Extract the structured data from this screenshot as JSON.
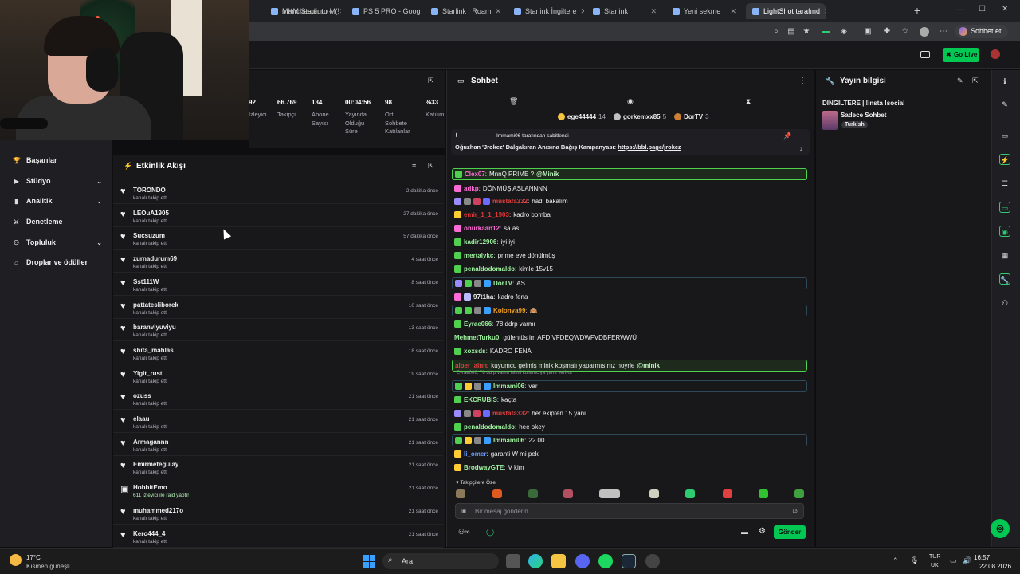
{
  "browser": {
    "tabs": [
      {
        "label": "MKM Stadium – (!",
        "active": false
      },
      {
        "label": "manchester to M",
        "active": false
      },
      {
        "label": "PS 5 PRO - Goog",
        "active": false
      },
      {
        "label": "Starlink | Roam",
        "active": false
      },
      {
        "label": "Starlink İngiltere",
        "active": false
      },
      {
        "label": "Starlink",
        "active": false
      },
      {
        "label": "Yeni sekme",
        "active": false
      },
      {
        "label": "LightShot tarafınd",
        "active": true
      }
    ],
    "profile_label": "Sohbet et"
  },
  "topnav": {
    "go_live": "Go Live"
  },
  "sidebar": {
    "items": [
      {
        "label": "Başarılar",
        "icon": "trophy-icon",
        "expandable": false
      },
      {
        "label": "Stüdyo",
        "icon": "video-icon",
        "expandable": true
      },
      {
        "label": "Analitik",
        "icon": "chart-icon",
        "expandable": true
      },
      {
        "label": "Denetleme",
        "icon": "sword-icon",
        "expandable": false
      },
      {
        "label": "Topluluk",
        "icon": "people-icon",
        "expandable": true
      },
      {
        "label": "Droplar ve ödüller",
        "icon": "gift-icon",
        "expandable": false
      }
    ]
  },
  "stats": [
    {
      "value": "92",
      "label": "Izleyici"
    },
    {
      "value": "66.769",
      "label": "Takipçi"
    },
    {
      "value": "134",
      "label": "Abone Sayısı"
    },
    {
      "value": "00:04:56",
      "label": "Yayında Olduğu Süre"
    },
    {
      "value": "98",
      "label": "Ort. Sohbete Katılanlar"
    },
    {
      "value": "%33",
      "label": "Katılım"
    }
  ],
  "feed": {
    "title": "Etkinlik Akışı",
    "items": [
      {
        "name": "TORONDO",
        "action": "kanalı takip etti",
        "time": "2 dakika önce",
        "icon": "heart-icon"
      },
      {
        "name": "LEOuA1905",
        "action": "kanalı takip etti",
        "time": "27 dakika önce",
        "icon": "heart-icon"
      },
      {
        "name": "Sucsuzum",
        "action": "kanalı takip etti",
        "time": "57 dakika önce",
        "icon": "heart-icon"
      },
      {
        "name": "zurnadurum69",
        "action": "kanalı takip etti",
        "time": "4 saat önce",
        "icon": "heart-icon"
      },
      {
        "name": "Sst111W",
        "action": "kanalı takip etti",
        "time": "8 saat önce",
        "icon": "heart-icon"
      },
      {
        "name": "pattatesliborek",
        "action": "kanalı takip etti",
        "time": "10 saat önce",
        "icon": "heart-icon"
      },
      {
        "name": "baranviyuviyu",
        "action": "kanalı takip etti",
        "time": "13 saat önce",
        "icon": "heart-icon"
      },
      {
        "name": "shifa_mahlas",
        "action": "kanalı takip etti",
        "time": "18 saat önce",
        "icon": "heart-icon"
      },
      {
        "name": "Yigit_rust",
        "action": "kanalı takip etti",
        "time": "19 saat önce",
        "icon": "heart-icon"
      },
      {
        "name": "ozuss",
        "action": "kanalı takip etti",
        "time": "21 saat önce",
        "icon": "heart-icon"
      },
      {
        "name": "elaau",
        "action": "kanalı takip etti",
        "time": "21 saat önce",
        "icon": "heart-icon"
      },
      {
        "name": "Armagannn",
        "action": "kanalı takip etti",
        "time": "21 saat önce",
        "icon": "heart-icon"
      },
      {
        "name": "Emirmeteguiay",
        "action": "kanalı takip etti",
        "time": "21 saat önce",
        "icon": "heart-icon"
      },
      {
        "name": "HobbitEmo",
        "action": "611 izleyici ile raid yaptı!",
        "time": "21 saat önce",
        "icon": "raid-icon"
      },
      {
        "name": "muhammed217o",
        "action": "kanalı takip etti",
        "time": "21 saat önce",
        "icon": "heart-icon"
      },
      {
        "name": "Kero444_4",
        "action": "kanalı takip etti",
        "time": "21 saat önce",
        "icon": "heart-icon"
      }
    ]
  },
  "chat": {
    "title": "Sohbet",
    "top_chatters": [
      {
        "name": "ege44444",
        "count": "14"
      },
      {
        "name": "gorkemxx85",
        "count": "5"
      },
      {
        "name": "DorTV",
        "count": "3"
      }
    ],
    "pinned_by": "Immami06 tarafından sabitlendi",
    "pinned_text": "Oğuzhan 'Jrokez' Dalgakıran Anısına Bağış Kampanyası:",
    "pinned_link": "https://bbl.page/jrokez",
    "messages": [
      {
        "user": "Clex07",
        "color": "#ff6bd6",
        "text": "MnnQ PRİME ?",
        "mention": "@Minik",
        "style": "hl",
        "badges": [
          "#4fd14f"
        ]
      },
      {
        "user": "adkp",
        "color": "#ff6bd6",
        "text": "DÖNMÜŞ ASLANNNN",
        "style": "",
        "badges": [
          "#ff6bd6"
        ]
      },
      {
        "user": "mustafa332",
        "color": "#e04040",
        "text": "hadi bakalım",
        "style": "",
        "badges": [
          "#9a8cff",
          "#888888",
          "#d04060",
          "#6b6bff"
        ]
      },
      {
        "user": "emir_1_1_1903",
        "color": "#e03535",
        "text": "kadro bomba",
        "style": "",
        "badges": [
          "#ffcc33"
        ]
      },
      {
        "user": "onurkaan12",
        "color": "#ff6bd6",
        "text": "sa as",
        "style": "",
        "badges": [
          "#ff6bd6"
        ]
      },
      {
        "user": "kadir12906",
        "color": "#9df29d",
        "text": "iyi iyi",
        "style": "",
        "badges": [
          "#4fd14f"
        ]
      },
      {
        "user": "mertalykc",
        "color": "#9df29d",
        "text": "prime eve dönülmüş",
        "style": "",
        "badges": [
          "#4fd14f"
        ]
      },
      {
        "user": "penaldodomaldo",
        "color": "#9df29d",
        "text": "kimle 15v15",
        "style": "",
        "badges": [
          "#4fd14f"
        ]
      },
      {
        "user": "DorTV",
        "color": "#9df29d",
        "text": "AS",
        "style": "hl2",
        "badges": [
          "#9a8cff",
          "#4fd14f",
          "#888888",
          "#3aa0ff"
        ]
      },
      {
        "user": "97t1ha",
        "color": "#efeff1",
        "text": "kadro fena",
        "style": "",
        "badges": [
          "#ff6bd6",
          "#bbbbff"
        ]
      },
      {
        "user": "Kolonya99",
        "color": "#f0a020",
        "text": "🙈",
        "style": "hl2",
        "badges": [
          "#4fd14f",
          "#4fd14f",
          "#888888",
          "#3aa0ff"
        ]
      },
      {
        "user": "Eyrae066",
        "color": "#9df29d",
        "text": "78 ddrp varmı",
        "style": "",
        "badges": [
          "#4fd14f"
        ]
      },
      {
        "user": "MehmetTurku0",
        "color": "#9df29d",
        "text": "gülentüs im AFD VFDEQWDWFVDBFERWWÜ",
        "style": "",
        "badges": []
      },
      {
        "user": "xoxsds",
        "color": "#9df29d",
        "text": "KADRO FENA",
        "style": "",
        "badges": [
          "#4fd14f"
        ]
      },
      {
        "user": "alper_alnn",
        "color": "#e04040",
        "text": "kuyumcu gelmiş minik koşmalı yaparmısınız noyrle",
        "mention": "@minik",
        "style": "hl",
        "badges": []
      },
      {
        "user": "Immami06",
        "color": "#9df29d",
        "text": "var",
        "reply": "Eyrae066: 78 ddrp varmı isimli kullanıcıya yanıt veriyor",
        "style": "hl2",
        "badges": [
          "#4fd14f",
          "#ffcc33",
          "#888888",
          "#3aa0ff"
        ]
      },
      {
        "user": "EKCRUBIS",
        "color": "#9df29d",
        "text": "kaçta",
        "style": "",
        "badges": [
          "#4fd14f"
        ]
      },
      {
        "user": "mustafa332",
        "color": "#e04040",
        "text": "her ekipten 15 yani",
        "style": "",
        "badges": [
          "#9a8cff",
          "#888888",
          "#d04060",
          "#6b6bff"
        ]
      },
      {
        "user": "penaldodomaldo",
        "color": "#9df29d",
        "text": "hee okey",
        "style": "",
        "badges": [
          "#4fd14f"
        ]
      },
      {
        "user": "Immami06",
        "color": "#9df29d",
        "text": "22.00",
        "style": "hl2",
        "badges": [
          "#4fd14f",
          "#ffcc33",
          "#888888",
          "#3aa0ff"
        ]
      },
      {
        "user": "li_omer",
        "color": "#6b9bff",
        "text": "garanti W mi peki",
        "style": "",
        "badges": [
          "#ffcc33"
        ]
      },
      {
        "user": "BrodwayGTE",
        "color": "#9df29d",
        "text": "V kim",
        "style": "",
        "badges": [
          "#ffcc33"
        ]
      }
    ],
    "followers_only": "♥ Takipçilere Özel",
    "input_placeholder": "Bir mesaj gönderin",
    "send_label": "Gönder"
  },
  "info": {
    "title": "Yayın bilgisi",
    "stream_title": "DINGILTERE | !insta !social",
    "category": "Sadece Sohbet",
    "tag": "Turkish"
  },
  "taskbar": {
    "weather_temp": "17°C",
    "weather_desc": "Kısmen güneşli",
    "search_label": "Ara",
    "lang": "TUR",
    "region": "UK",
    "time": "16:57",
    "date": "22.08.2026"
  },
  "colors": {
    "accent_green": "#00c853",
    "panel_bg": "#18181b",
    "page_bg": "#0e0e10"
  }
}
